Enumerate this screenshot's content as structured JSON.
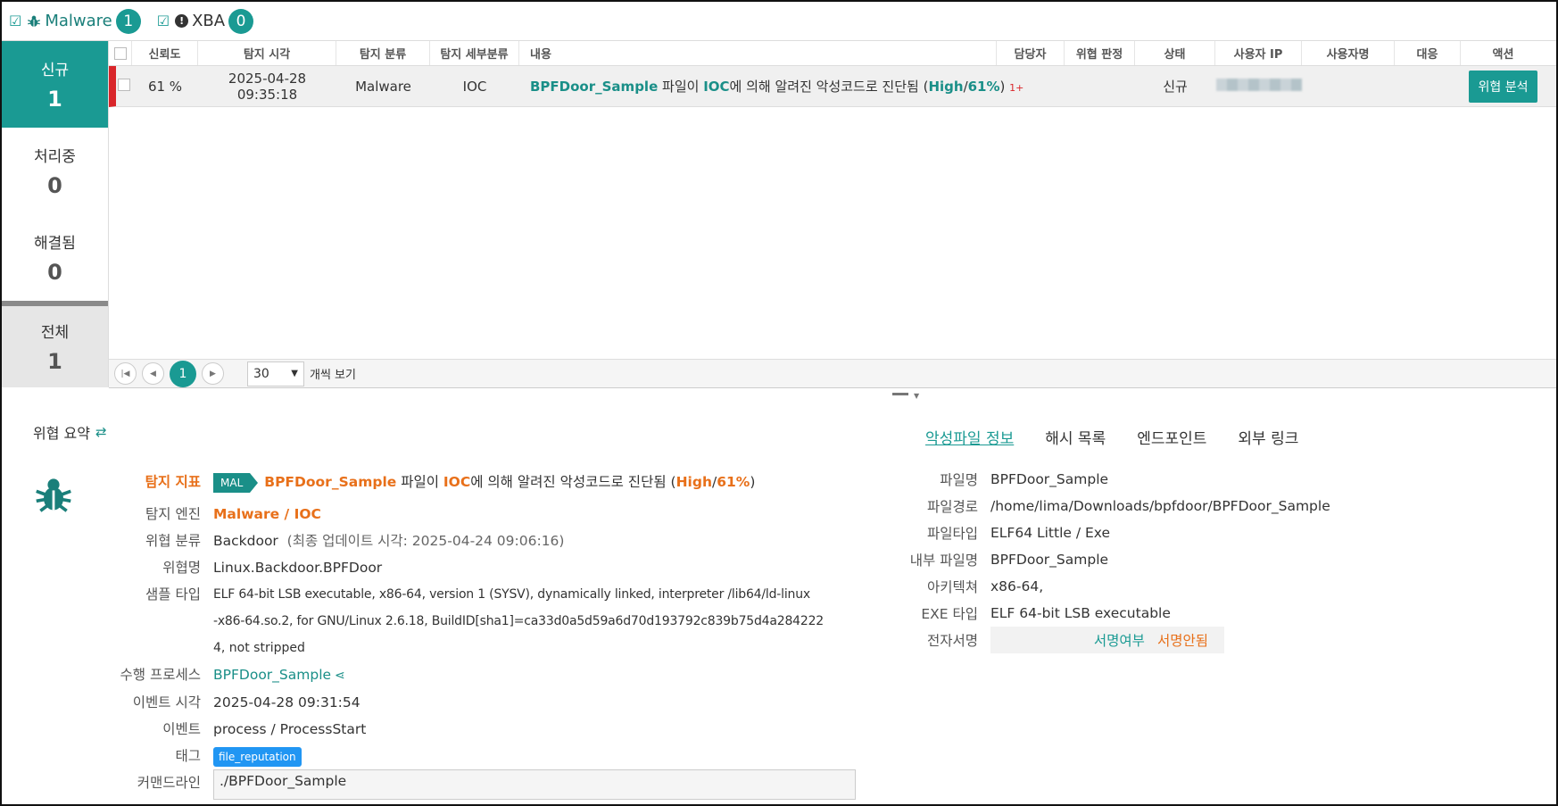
{
  "filters": [
    {
      "label": "Malware",
      "count": "1"
    },
    {
      "label": "XBA",
      "count": "0"
    }
  ],
  "status": [
    {
      "label": "신규",
      "count": "1"
    },
    {
      "label": "처리중",
      "count": "0"
    },
    {
      "label": "해결됨",
      "count": "0"
    },
    {
      "label": "전체",
      "count": "1"
    }
  ],
  "table": {
    "headers": [
      "신뢰도",
      "탐지 시각",
      "탐지 분류",
      "탐지 세부분류",
      "내용",
      "담당자",
      "위협 판정",
      "상태",
      "사용자 IP",
      "사용자명",
      "대응",
      "액션"
    ],
    "row": {
      "confidence": "61 %",
      "time": "2025-04-28 09:35:18",
      "category": "Malware",
      "subcategory": "IOC",
      "content": {
        "file": "BPFDoor_Sample",
        "t1": " 파일이 ",
        "ioc": "IOC",
        "t2": "에 의해 알려진 악성코드로 진단됨 (",
        "level": "High",
        "slash": "/",
        "pct": "61%",
        "close": ")",
        "extra": "1+"
      },
      "status": "신규",
      "action": "위협 분석"
    }
  },
  "pager": {
    "current": "1",
    "page_size": "30",
    "per_page_label": "개씩 보기"
  },
  "detail": {
    "title": "위협 요약",
    "labels": {
      "indicator": "탐지 지표",
      "engine": "탐지 엔진",
      "threat_class": "위협 분류",
      "threat_name": "위협명",
      "sample_type": "샘플 타입",
      "process": "수행 프로세스",
      "event_time": "이벤트 시각",
      "event": "이벤트",
      "tag": "태그",
      "cmdline": "커맨드라인"
    },
    "indicator": {
      "badge": "MAL",
      "file": "BPFDoor_Sample",
      "t1": " 파일이 ",
      "ioc": "IOC",
      "t2": "에 의해 알려진 악성코드로 진단됨 (",
      "level": "High",
      "slash": "/",
      "pct": "61%",
      "close": ")"
    },
    "engine": "Malware / IOC",
    "threat_class": "Backdoor",
    "threat_class_update": "(최종 업데이트 시각: 2025-04-24 09:06:16)",
    "threat_name": "Linux.Backdoor.BPFDoor",
    "sample_type_lines": [
      "ELF 64-bit LSB executable, x86-64, version 1 (SYSV), dynamically linked, interpreter /lib64/ld-linux",
      "-x86-64.so.2, for GNU/Linux 2.6.18, BuildID[sha1]=ca33d0a5d59a6d70d193792c839b75d4a284222",
      "4, not stripped"
    ],
    "process": "BPFDoor_Sample",
    "event_time": "2025-04-28 09:31:54",
    "event": "process / ProcessStart",
    "tag": "file_reputation",
    "cmdline": "./BPFDoor_Sample"
  },
  "tabs": [
    "악성파일 정보",
    "해시 목록",
    "엔드포인트",
    "외부 링크"
  ],
  "file_info": {
    "labels": {
      "name": "파일명",
      "path": "파일경로",
      "type": "파일타입",
      "internal_name": "내부 파일명",
      "arch": "아키텍쳐",
      "exe_type": "EXE 타입",
      "signature": "전자서명"
    },
    "name": "BPFDoor_Sample",
    "path": "/home/lima/Downloads/bpfdoor/BPFDoor_Sample",
    "type": "ELF64 Little / Exe",
    "internal_name": "BPFDoor_Sample",
    "arch": "x86-64,",
    "exe_type": "ELF 64-bit LSB executable",
    "sig_label": "서명여부",
    "sig_value": "서명안됨"
  },
  "colors": {
    "accent": "#1a9a93",
    "alert": "#d9252a",
    "highlight": "#e8701a",
    "tag": "#2196f3"
  }
}
